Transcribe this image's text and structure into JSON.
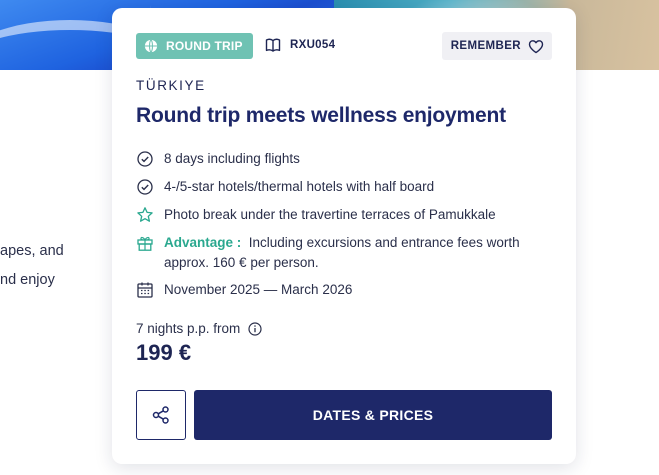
{
  "background": {
    "text_line_1": "apes, and",
    "text_line_2": "nd enjoy"
  },
  "card": {
    "badge": {
      "label": "ROUND TRIP",
      "icon": "globe-icon",
      "color": "#6fc2b3"
    },
    "trip_code": {
      "label": "RXU054",
      "icon": "book-icon"
    },
    "remember": {
      "label": "REMEMBER",
      "icon": "heart-icon"
    },
    "country": "TÜRKIYE",
    "title": "Round trip meets wellness enjoyment",
    "features": [
      {
        "icon": "check-circle-icon",
        "text": "8 days including flights"
      },
      {
        "icon": "check-circle-icon",
        "text": "4-/5-star hotels/thermal hotels with half board"
      },
      {
        "icon": "star-icon",
        "text": "Photo break under the travertine terraces of Pamukkale"
      },
      {
        "icon": "gift-icon",
        "label": "Advantage :",
        "text": "Including excursions and entrance fees worth approx. 160 € per person."
      },
      {
        "icon": "calendar-icon",
        "text": "November 2025 — March 2026"
      }
    ],
    "price_from_label": "7 nights p.p. from",
    "price": "199 €",
    "share": {
      "icon": "share-icon"
    },
    "cta_label": "DATES & PRICES",
    "accent_color": "#1e2869"
  }
}
